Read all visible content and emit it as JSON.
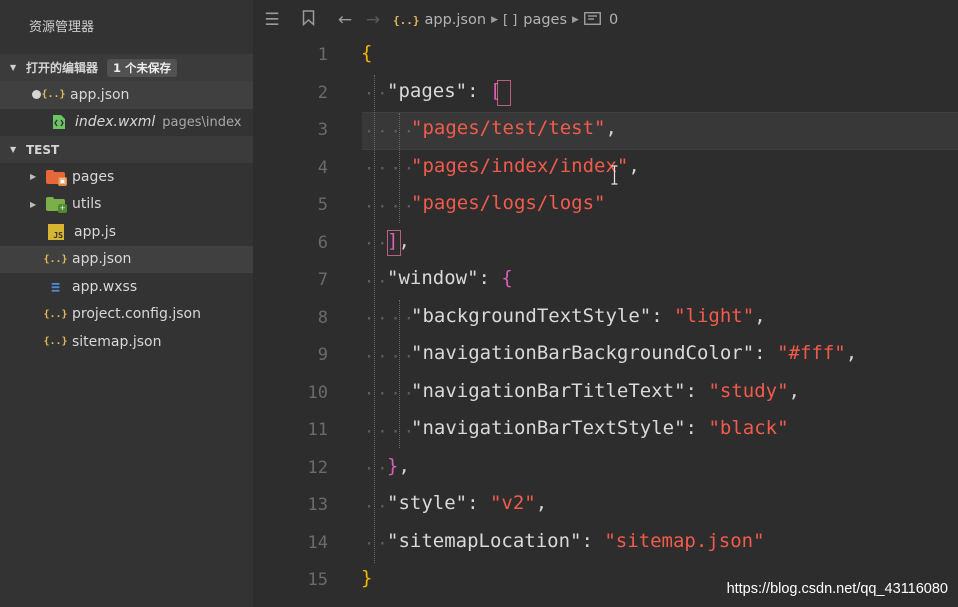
{
  "sidebar": {
    "title": "资源管理器",
    "open_editors": {
      "label": "打开的编辑器",
      "badge": "1 个未保存",
      "items": [
        {
          "name": "app.json",
          "icon": "json-icon",
          "detail": ""
        },
        {
          "name": "index.wxml",
          "icon": "wxml-icon",
          "detail": "pages\\index"
        }
      ]
    },
    "project": {
      "label": "TEST",
      "items": [
        {
          "name": "pages",
          "icon": "folder-icon"
        },
        {
          "name": "utils",
          "icon": "folder-icon"
        },
        {
          "name": "app.js",
          "icon": "js-icon"
        },
        {
          "name": "app.json",
          "icon": "json-icon"
        },
        {
          "name": "app.wxss",
          "icon": "wxss-icon"
        },
        {
          "name": "project.config.json",
          "icon": "json-icon"
        },
        {
          "name": "sitemap.json",
          "icon": "json-icon"
        }
      ]
    }
  },
  "editor": {
    "breadcrumb": {
      "file": "app.json",
      "segment": "pages",
      "index": "0",
      "json_glyph": "{..}",
      "array_glyph": "[ ]"
    },
    "line_numbers": [
      "1",
      "2",
      "3",
      "4",
      "5",
      "6",
      "7",
      "8",
      "9",
      "10",
      "11",
      "12",
      "13",
      "14",
      "15"
    ],
    "code": {
      "k_pages": "\"pages\"",
      "v_test": "\"pages/test/test\"",
      "v_index": "\"pages/index/index\"",
      "v_logs": "\"pages/logs/logs\"",
      "k_window": "\"window\"",
      "k_bts": "\"backgroundTextStyle\"",
      "v_light": "\"light\"",
      "k_nbbc": "\"navigationBarBackgroundColor\"",
      "v_fff": "\"#fff\"",
      "k_nbtt": "\"navigationBarTitleText\"",
      "v_study": "\"study\"",
      "k_nbts": "\"navigationBarTextStyle\"",
      "v_black": "\"black\"",
      "k_style": "\"style\"",
      "v_v2": "\"v2\"",
      "k_sitemap": "\"sitemapLocation\"",
      "v_sitemap": "\"sitemap.json\""
    }
  },
  "watermark": "https://blog.csdn.net/qq_43116080",
  "colors": {
    "sidebar_bg": "#333333",
    "editor_bg": "#2d2d2d",
    "string": "#f25b4b",
    "brace": "#f2b500",
    "bracket": "#d85fb5"
  }
}
